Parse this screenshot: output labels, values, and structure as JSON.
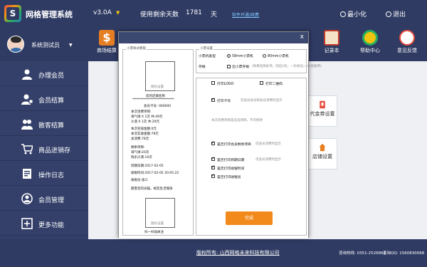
{
  "app": {
    "title": "网格管理系统",
    "version": "v3.0A",
    "remaining_label": "使用剩余天数",
    "remaining_days": "1781",
    "remaining_unit": "天",
    "renew_link": "软件开通/续费",
    "minimize": "最小化",
    "exit": "退出"
  },
  "user": {
    "name": "系统测试员"
  },
  "ribbon": [
    {
      "label": "商场结算",
      "icon": "dollar-icon"
    },
    {
      "label": "记录本",
      "icon": "notebook-icon"
    },
    {
      "label": "帮助中心",
      "icon": "help-icon"
    },
    {
      "label": "意见反馈",
      "icon": "feedback-icon"
    }
  ],
  "sidebar": [
    {
      "label": "办理会员",
      "icon": "user-icon"
    },
    {
      "label": "会员结算",
      "icon": "member-checkout-icon"
    },
    {
      "label": "散客结算",
      "icon": "group-icon"
    },
    {
      "label": "商品进销存",
      "icon": "cart-icon"
    },
    {
      "label": "操作日志",
      "icon": "log-icon"
    },
    {
      "label": "会员管理",
      "icon": "member-manage-icon"
    },
    {
      "label": "更多功能",
      "icon": "plus-icon"
    }
  ],
  "tiles": [
    {
      "label": "代金券设置",
      "icon": "coupon-icon"
    },
    {
      "label": "店铺设置",
      "icon": "shop-icon"
    }
  ],
  "dialog": {
    "close": "x",
    "receipt_legend": "小票样式模版",
    "logo_placeholder": "图标设置",
    "shop_name": "您的店铺名称",
    "divider": "******************************",
    "lines": [
      "会员卡号: 000000",
      "本次消费项目:",
      "海气球 X 1次 共:49元",
      "沙漠 X 1次 共:29元",
      "本次充值金额:0元",
      "本次实收金额:78元",
      "总消费:78元",
      "剩余项目:",
      "海气球:20次",
      "快乐沙漠:10次",
      "到期日期:2017-02-05",
      "收银时间:2017-02-05 20:05:22",
      "收银员:张三",
      "愿客您的光临，祝您生活愉快"
    ],
    "qr_placeholder": "图标设置",
    "qr_caption": "扫一扫加关注",
    "settings_legend": "小票设置",
    "type_label": "小票机类型",
    "type_58": "58mm小票机",
    "type_80": "80mm小票机",
    "save_label": "存根",
    "save_option": "出小票存根",
    "save_hint": "(如果选择此项，则出2份，一份会员,一份留备用)",
    "opt_print_logo": "打印LOGO",
    "opt_print_qr": "打印二维码",
    "opt_card": "打印卡号",
    "opt_card_hint": "仅会员会员和会员消费时显示",
    "static_note": "本次消费项目是必选项目，不可修改",
    "opt_remaining": "是否打印会员剩余项目",
    "opt_remaining_hint": "仅会员消费时显示",
    "opt_expire": "是否打印到期日期",
    "opt_expire_hint": "仅会员消费时显示",
    "opt_time": "是否打印收银时间",
    "opt_cashier": "是否打印收银员",
    "done": "完成"
  },
  "footer": {
    "copyright": "版权所有: 山西网格未来科技有限公司",
    "hotline": "咨询热线: 0351-2526861",
    "qq": "咨询QQ: 1560830068"
  }
}
